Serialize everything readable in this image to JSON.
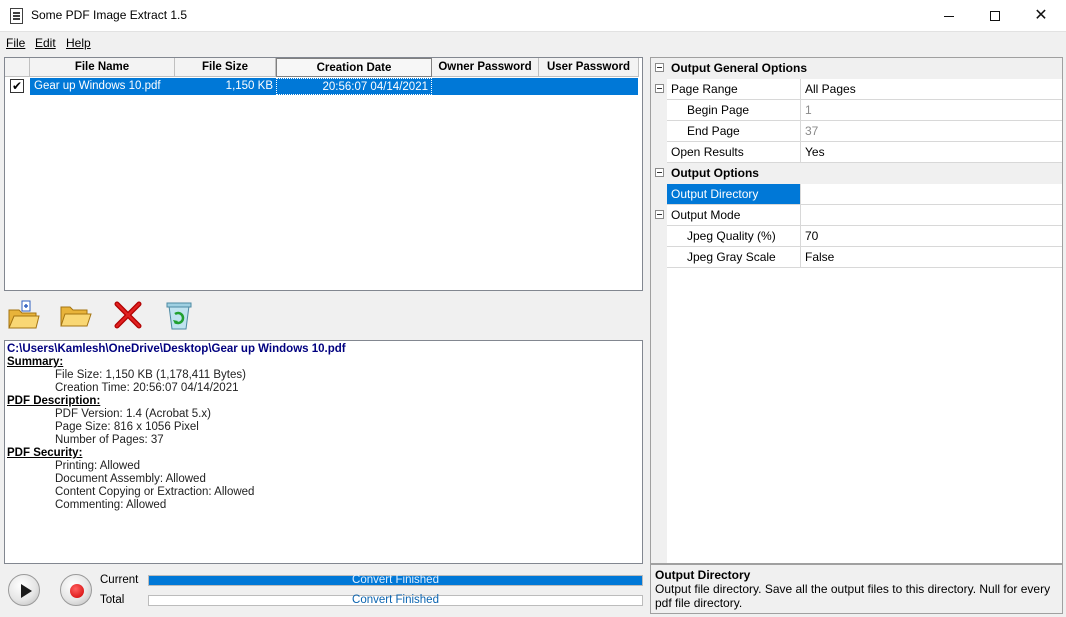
{
  "window": {
    "title": "Some PDF Image Extract 1.5",
    "controls": [
      "minimize-icon",
      "maximize-icon",
      "close-icon"
    ]
  },
  "menu": {
    "file": "File",
    "edit": "Edit",
    "help": "Help"
  },
  "file_list": {
    "columns": [
      "File Name",
      "File Size",
      "Creation Date",
      "Owner Password",
      "User Password"
    ],
    "rows": [
      {
        "checked": true,
        "file_name": "Gear up Windows 10.pdf",
        "file_size": "1,150 KB",
        "creation_date": "20:56:07 04/14/2021",
        "owner_password": "",
        "user_password": ""
      }
    ]
  },
  "toolbar": {
    "icons": [
      "add-file-icon",
      "open-folder-icon",
      "delete-icon",
      "clear-all-icon"
    ]
  },
  "info": {
    "path": "C:\\Users\\Kamlesh\\OneDrive\\Desktop\\Gear up Windows 10.pdf",
    "summary_title": "Summary:",
    "summary": [
      "File Size: 1,150 KB (1,178,411 Bytes)",
      "Creation Time: 20:56:07 04/14/2021"
    ],
    "desc_title": "PDF Description:",
    "desc": [
      "PDF Version: 1.4 (Acrobat 5.x)",
      "Page Size: 816 x 1056 Pixel",
      "Number of Pages: 37"
    ],
    "security_title": "PDF Security:",
    "security": [
      "Printing: Allowed",
      "Document Assembly: Allowed",
      "Content Copying or Extraction: Allowed",
      "Commenting: Allowed"
    ]
  },
  "progress": {
    "current_label": "Current",
    "current_text": "Convert Finished",
    "current_fraction": 1.0,
    "total_label": "Total",
    "total_text": "Convert Finished",
    "total_fraction": 0.0
  },
  "properties": {
    "cat_general": "Output General Options",
    "page_range_name": "Page Range",
    "page_range_value": "All Pages",
    "begin_page_name": "Begin Page",
    "begin_page_value": "1",
    "end_page_name": "End Page",
    "end_page_value": "37",
    "open_results_name": "Open Results",
    "open_results_value": "Yes",
    "cat_output": "Output Options",
    "output_dir_name": "Output Directory",
    "output_dir_value": "",
    "output_mode_name": "Output Mode",
    "jpeg_quality_name": "Jpeg Quality (%)",
    "jpeg_quality_value": "70",
    "jpeg_gray_name": "Jpeg Gray Scale",
    "jpeg_gray_value": "False"
  },
  "description": {
    "title": "Output Directory",
    "text": "Output file directory. Save all the output files to this directory. Null for every pdf file directory."
  },
  "colors": {
    "selection": "#0078d7",
    "path_text": "#00007f",
    "delete_red": "#cc0000",
    "folder_yellow": "#f5c542"
  }
}
